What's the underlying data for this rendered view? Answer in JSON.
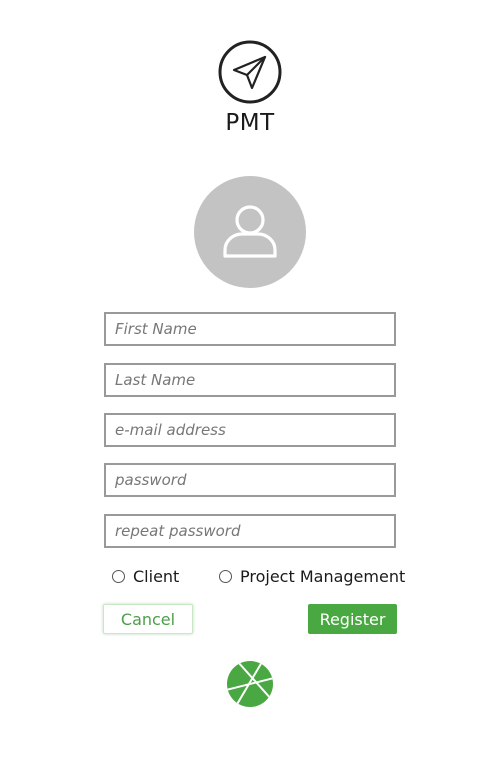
{
  "header": {
    "title": "PMT",
    "logo_icon": "paper-plane-icon"
  },
  "avatar": {
    "icon": "user-silhouette-icon",
    "background": "#c3c3c3"
  },
  "form": {
    "first_name": {
      "placeholder": "First Name",
      "value": ""
    },
    "last_name": {
      "placeholder": "Last Name",
      "value": ""
    },
    "email": {
      "placeholder": "e-mail address",
      "value": ""
    },
    "password": {
      "placeholder": "password",
      "value": ""
    },
    "repeat_password": {
      "placeholder": "repeat password",
      "value": ""
    },
    "role_options": [
      {
        "label": "Client",
        "selected": false
      },
      {
        "label": "Project Management",
        "selected": false
      }
    ]
  },
  "actions": {
    "cancel_label": "Cancel",
    "register_label": "Register"
  },
  "footer": {
    "logo_icon": "green-circle-logo-icon"
  },
  "colors": {
    "accent_green": "#4aa842",
    "field_border": "#999999",
    "avatar_gray": "#c3c3c3"
  }
}
